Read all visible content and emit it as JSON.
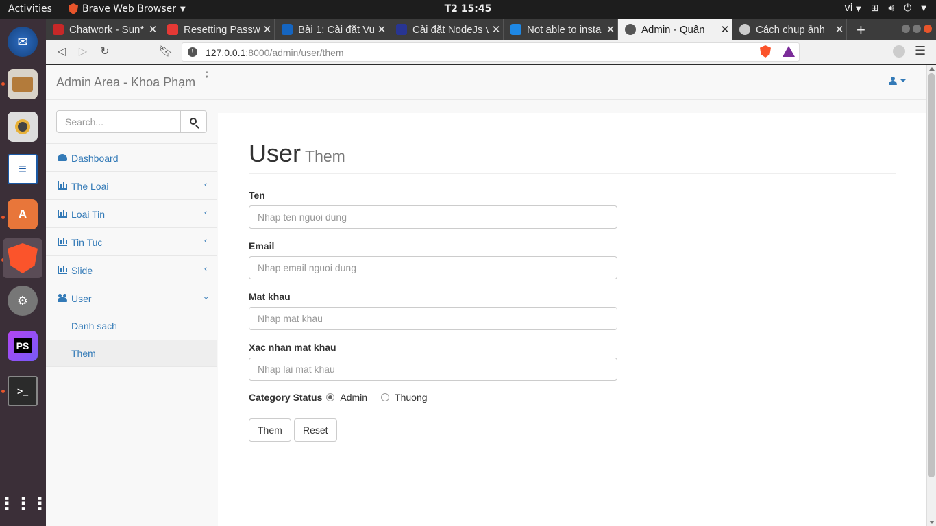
{
  "system": {
    "activities": "Activities",
    "app_name": "Brave Web Browser",
    "clock": "T2 15:45",
    "language": "vi"
  },
  "browser": {
    "tabs": [
      {
        "title": "Chatwork - Sun*",
        "color": "#c62828"
      },
      {
        "title": "Resetting Passw",
        "color": "#e53935"
      },
      {
        "title": "Bài 1: Cài đặt Vu",
        "color": "#1565c0"
      },
      {
        "title": "Cài đặt NodeJs v",
        "color": "#283593"
      },
      {
        "title": "Not able to insta",
        "color": "#1e88e5"
      },
      {
        "title": "Admin - Quân",
        "color": "#555555"
      },
      {
        "title": "Cách chụp ảnh",
        "color": "#cccccc"
      }
    ],
    "url_host": "127.0.0.1",
    "url_path": ":8000/admin/user/them"
  },
  "header": {
    "brand": "Admin Area - Khoa Phạm",
    "stray": ";"
  },
  "sidebar": {
    "search_placeholder": "Search...",
    "items": [
      {
        "label": "Dashboard"
      },
      {
        "label": "The Loai"
      },
      {
        "label": "Loai Tin"
      },
      {
        "label": "Tin Tuc"
      },
      {
        "label": "Slide"
      },
      {
        "label": "User"
      }
    ],
    "user_sub": [
      {
        "label": "Danh sach"
      },
      {
        "label": "Them"
      }
    ]
  },
  "main": {
    "title": "User",
    "subtitle": "Them",
    "fields": [
      {
        "label": "Ten",
        "placeholder": "Nhap ten nguoi dung"
      },
      {
        "label": "Email",
        "placeholder": "Nhap email nguoi dung"
      },
      {
        "label": "Mat khau",
        "placeholder": "Nhap mat khau"
      },
      {
        "label": "Xac nhan mat khau",
        "placeholder": "Nhap lai mat khau"
      }
    ],
    "status_label": "Category Status",
    "status_options": [
      "Admin",
      "Thuong"
    ],
    "status_selected": "Admin",
    "submit_label": "Them",
    "reset_label": "Reset"
  },
  "colors": {
    "link": "#337ab7",
    "brave": "#fb542b"
  }
}
